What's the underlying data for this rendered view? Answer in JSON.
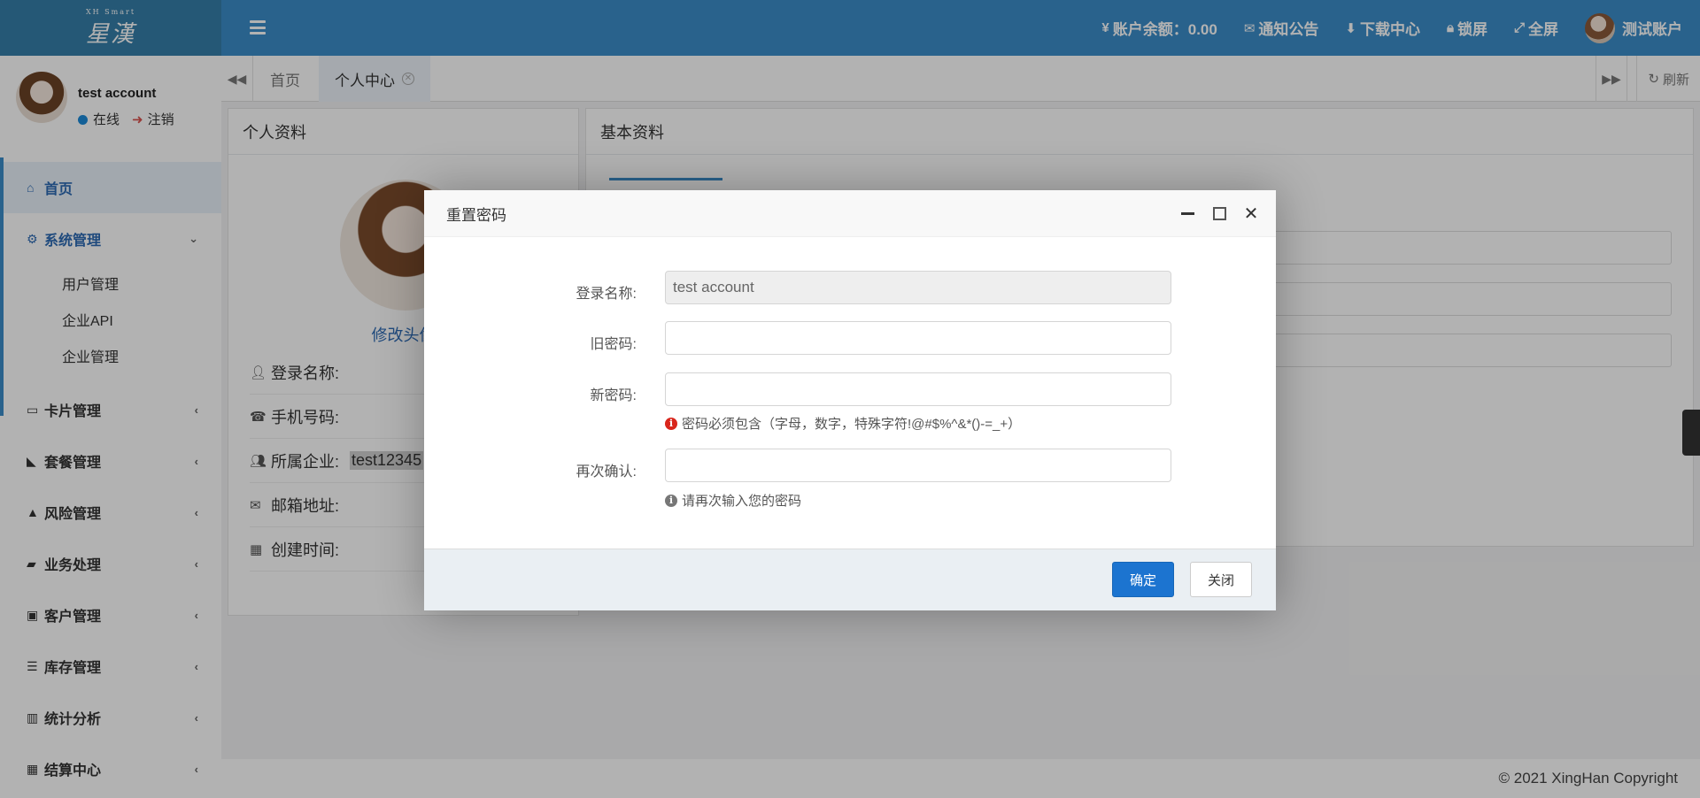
{
  "header": {
    "logo_text": "星漢",
    "logo_sub": "XH Smart",
    "balance_label": "账户余额：0.00",
    "notice_label": "通知公告",
    "download_label": "下载中心",
    "lock_label": "锁屏",
    "fullscreen_label": "全屏",
    "account_label": "测试账户"
  },
  "sidebar": {
    "user_name": "test account",
    "status_online": "在线",
    "status_logout": "注销",
    "menu": [
      {
        "label": "首页",
        "icon": "home-icon"
      },
      {
        "label": "系统管理",
        "icon": "gear-icon"
      },
      {
        "label": "卡片管理",
        "icon": "card-icon"
      },
      {
        "label": "套餐管理",
        "icon": "chart-icon"
      },
      {
        "label": "风险管理",
        "icon": "warning-icon"
      },
      {
        "label": "业务处理",
        "icon": "book-icon"
      },
      {
        "label": "客户管理",
        "icon": "contact-icon"
      },
      {
        "label": "库存管理",
        "icon": "database-icon"
      },
      {
        "label": "统计分析",
        "icon": "bar-chart-icon"
      },
      {
        "label": "结算中心",
        "icon": "calculator-icon"
      }
    ],
    "submenu": [
      "用户管理",
      "企业API",
      "企业管理"
    ]
  },
  "tabs": {
    "home": "首页",
    "profile": "个人中心",
    "refresh": "刷新"
  },
  "profile_panel": {
    "title": "个人资料",
    "change_avatar": "修改头像",
    "rows": [
      {
        "label": "登录名称:",
        "value": ""
      },
      {
        "label": "手机号码:",
        "value": ""
      },
      {
        "label": "所属企业:",
        "value": "test12345"
      },
      {
        "label": "邮箱地址:",
        "value": ""
      },
      {
        "label": "创建时间:",
        "value": ""
      }
    ]
  },
  "basic_panel": {
    "title": "基本资料"
  },
  "dialog": {
    "title": "重置密码",
    "fields": {
      "login_name_label": "登录名称:",
      "login_name_value": "test account",
      "old_pwd_label": "旧密码:",
      "new_pwd_label": "新密码:",
      "new_pwd_hint": "密码必须包含（字母，数字，特殊字符!@#$%^&*()-=_+）",
      "confirm_label": "再次确认:",
      "confirm_hint": "请再次输入您的密码"
    },
    "ok_label": "确定",
    "close_label": "关闭"
  },
  "footer": {
    "copyright": "© 2021 XingHan Copyright"
  }
}
